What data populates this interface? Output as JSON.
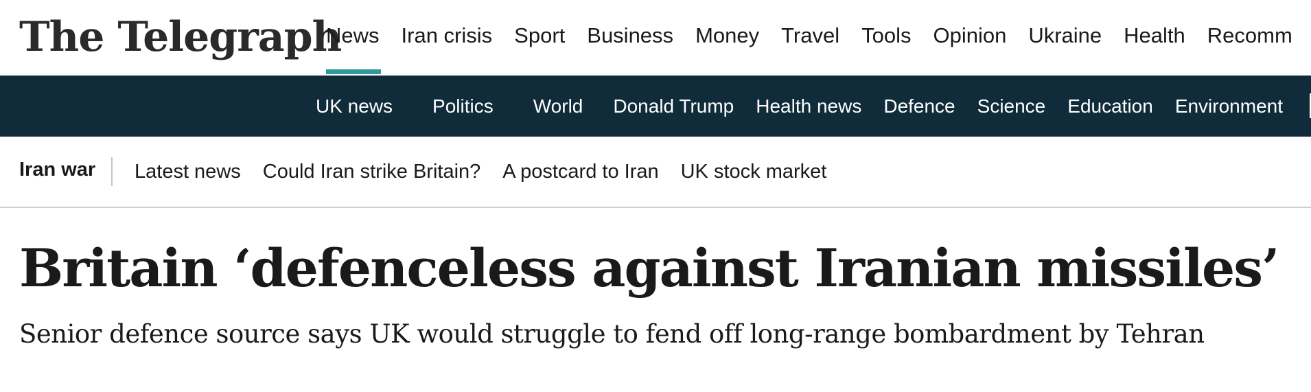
{
  "masthead": {
    "logo_text": "The Telegraph",
    "primary_nav": [
      {
        "label": "News",
        "active": true
      },
      {
        "label": "Iran crisis",
        "active": false
      },
      {
        "label": "Sport",
        "active": false
      },
      {
        "label": "Business",
        "active": false
      },
      {
        "label": "Money",
        "active": false
      },
      {
        "label": "Travel",
        "active": false
      },
      {
        "label": "Tools",
        "active": false
      },
      {
        "label": "Opinion",
        "active": false
      },
      {
        "label": "Ukraine",
        "active": false
      },
      {
        "label": "Health",
        "active": false
      },
      {
        "label": "Recomm",
        "active": false
      }
    ],
    "active_indicator_color": "#2f9a99"
  },
  "subnav": {
    "background_color": "#102b3a",
    "items": [
      {
        "label": "UK news"
      },
      {
        "label": "Politics"
      },
      {
        "label": "World"
      },
      {
        "label": "Donald Trump"
      },
      {
        "label": "Health news"
      },
      {
        "label": "Defence"
      },
      {
        "label": "Science"
      },
      {
        "label": "Education"
      },
      {
        "label": "Environment"
      }
    ]
  },
  "topic_strip": {
    "label": "Iran war",
    "links": [
      {
        "label": "Latest news"
      },
      {
        "label": "Could Iran strike Britain?"
      },
      {
        "label": "A postcard to Iran"
      },
      {
        "label": "UK stock market"
      }
    ]
  },
  "article": {
    "headline": "Britain ‘defenceless against Iranian missiles’",
    "standfirst": "Senior defence source says UK would struggle to fend off long-range bombardment by Tehran"
  }
}
